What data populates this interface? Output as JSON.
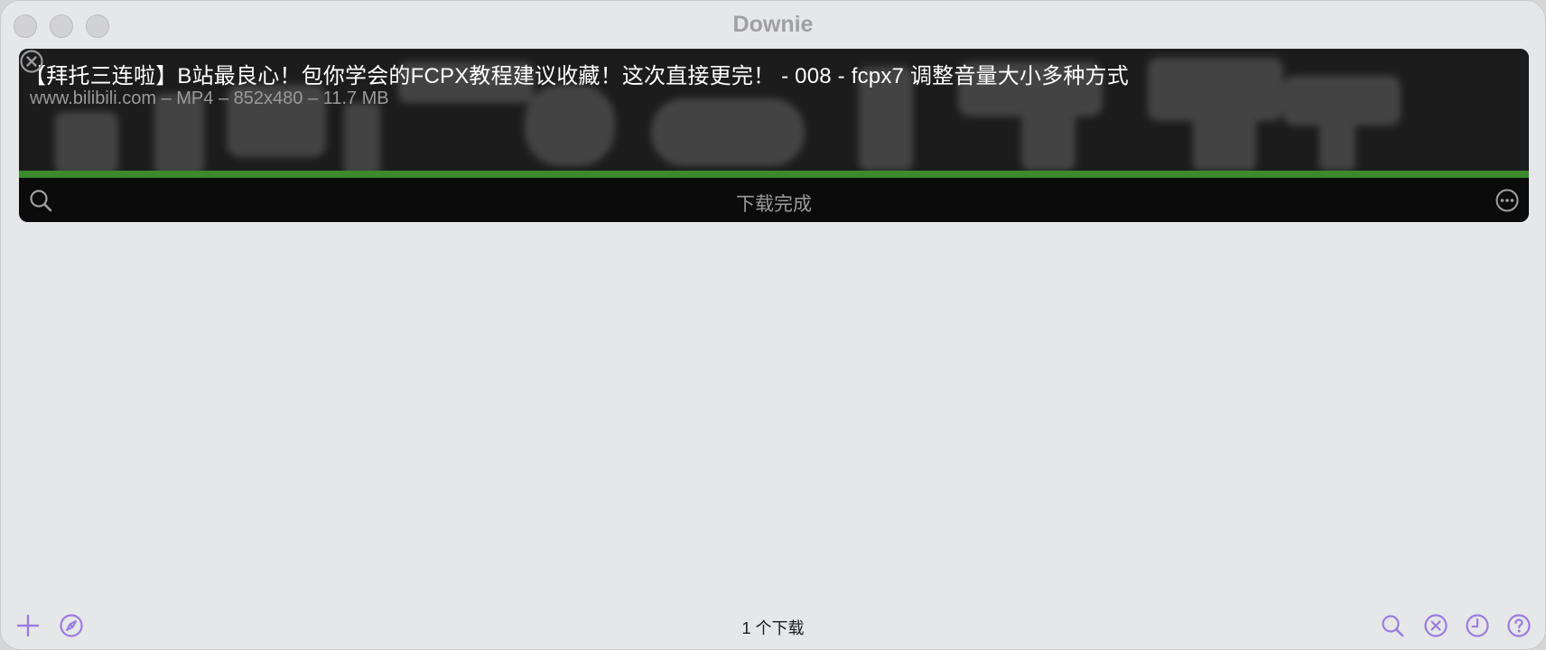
{
  "window": {
    "title": "Downie"
  },
  "download": {
    "title": "【拜托三连啦】B站最良心！包你学会的FCPX教程建议收藏！这次直接更完！ - 008 - fcpx7 调整音量大小多种方式",
    "meta": "www.bilibili.com – MP4 – 852x480 – 11.7 MB",
    "status": "下载完成",
    "progress": 1.0,
    "icons": {
      "close": "close-circle-icon",
      "search": "search-icon",
      "more": "more-circle-icon"
    }
  },
  "footer": {
    "count_text": "1 个下载",
    "left_icons": [
      "plus-icon",
      "compass-icon"
    ],
    "right_icons": [
      "search-icon",
      "close-circle-icon",
      "clock-icon",
      "help-icon"
    ]
  },
  "colors": {
    "accent": "#9a7de0",
    "progress": "#3b8a2c",
    "window_bg": "#e6e7e9",
    "card_bg": "#0b0b0b"
  }
}
